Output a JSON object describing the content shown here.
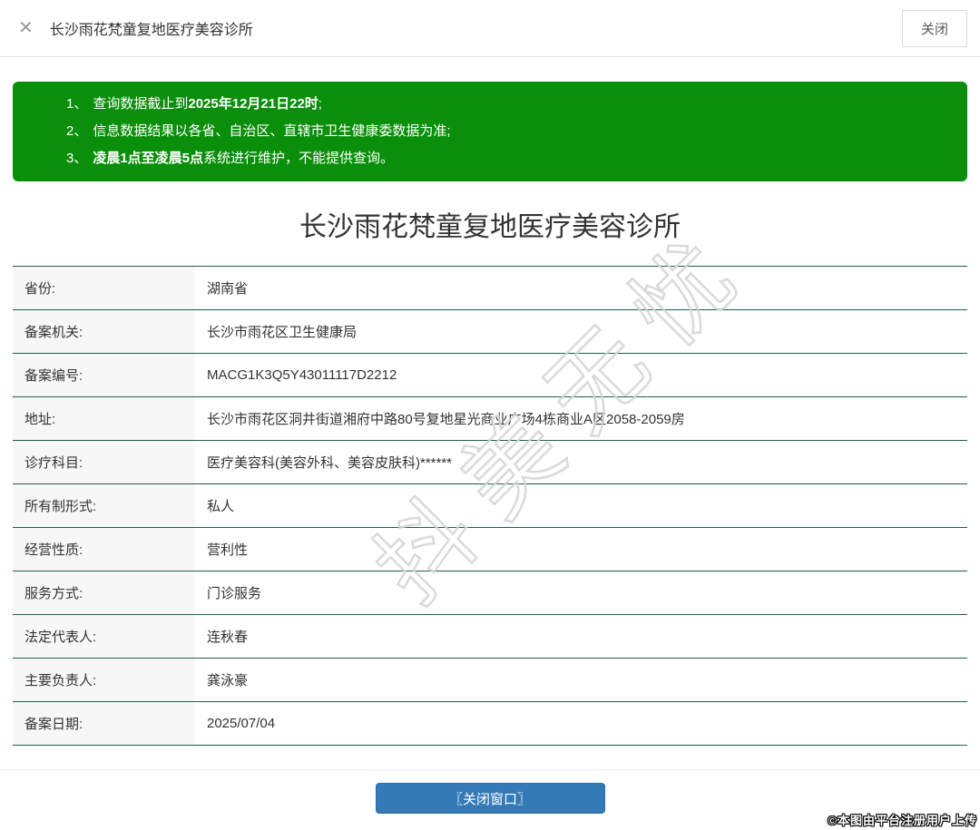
{
  "window": {
    "close_icon": "✕",
    "title": "长沙雨花梵童复地医疗美容诊所",
    "close_button_label": "关闭"
  },
  "notice": {
    "items": [
      {
        "num": "1、",
        "pre": "查询数据截止到",
        "bold": "2025年12月21日22时",
        "post": ";"
      },
      {
        "num": "2、",
        "pre": "信息数据结果以各省、自治区、直辖市卫生健康委数据为准;",
        "bold": "",
        "post": ""
      },
      {
        "num": "3、",
        "pre": "",
        "bold": "凌晨1点至凌晨5点",
        "post": "系统进行维护，不能提供查询。"
      }
    ]
  },
  "detail": {
    "title": "长沙雨花梵童复地医疗美容诊所",
    "rows": [
      {
        "label": "省份:",
        "value": "湖南省"
      },
      {
        "label": "备案机关:",
        "value": "长沙市雨花区卫生健康局"
      },
      {
        "label": "备案编号:",
        "value": "MACG1K3Q5Y43011117D2212"
      },
      {
        "label": "地址:",
        "value": "长沙市雨花区洞井街道湘府中路80号复地星光商业广场4栋商业A区2058-2059房"
      },
      {
        "label": "诊疗科目:",
        "value": "医疗美容科(美容外科、美容皮肤科)******"
      },
      {
        "label": "所有制形式:",
        "value": "私人"
      },
      {
        "label": "经营性质:",
        "value": "营利性"
      },
      {
        "label": "服务方式:",
        "value": "门诊服务"
      },
      {
        "label": "法定代表人:",
        "value": "连秋春"
      },
      {
        "label": "主要负责人:",
        "value": "龚泳豪"
      },
      {
        "label": "备案日期:",
        "value": "2025/07/04"
      }
    ]
  },
  "footer": {
    "close_window_button": "〖关闭窗口〗",
    "upload_watermark": "©本图由平台注册用户上传"
  },
  "watermark": {
    "diagonal_text": "抖美无忧"
  },
  "colors": {
    "notice_green": "#0a8f0a",
    "table_line_teal": "#1f5f52",
    "button_blue": "#337ab7",
    "label_cell_bg": "#f7f7f7"
  }
}
